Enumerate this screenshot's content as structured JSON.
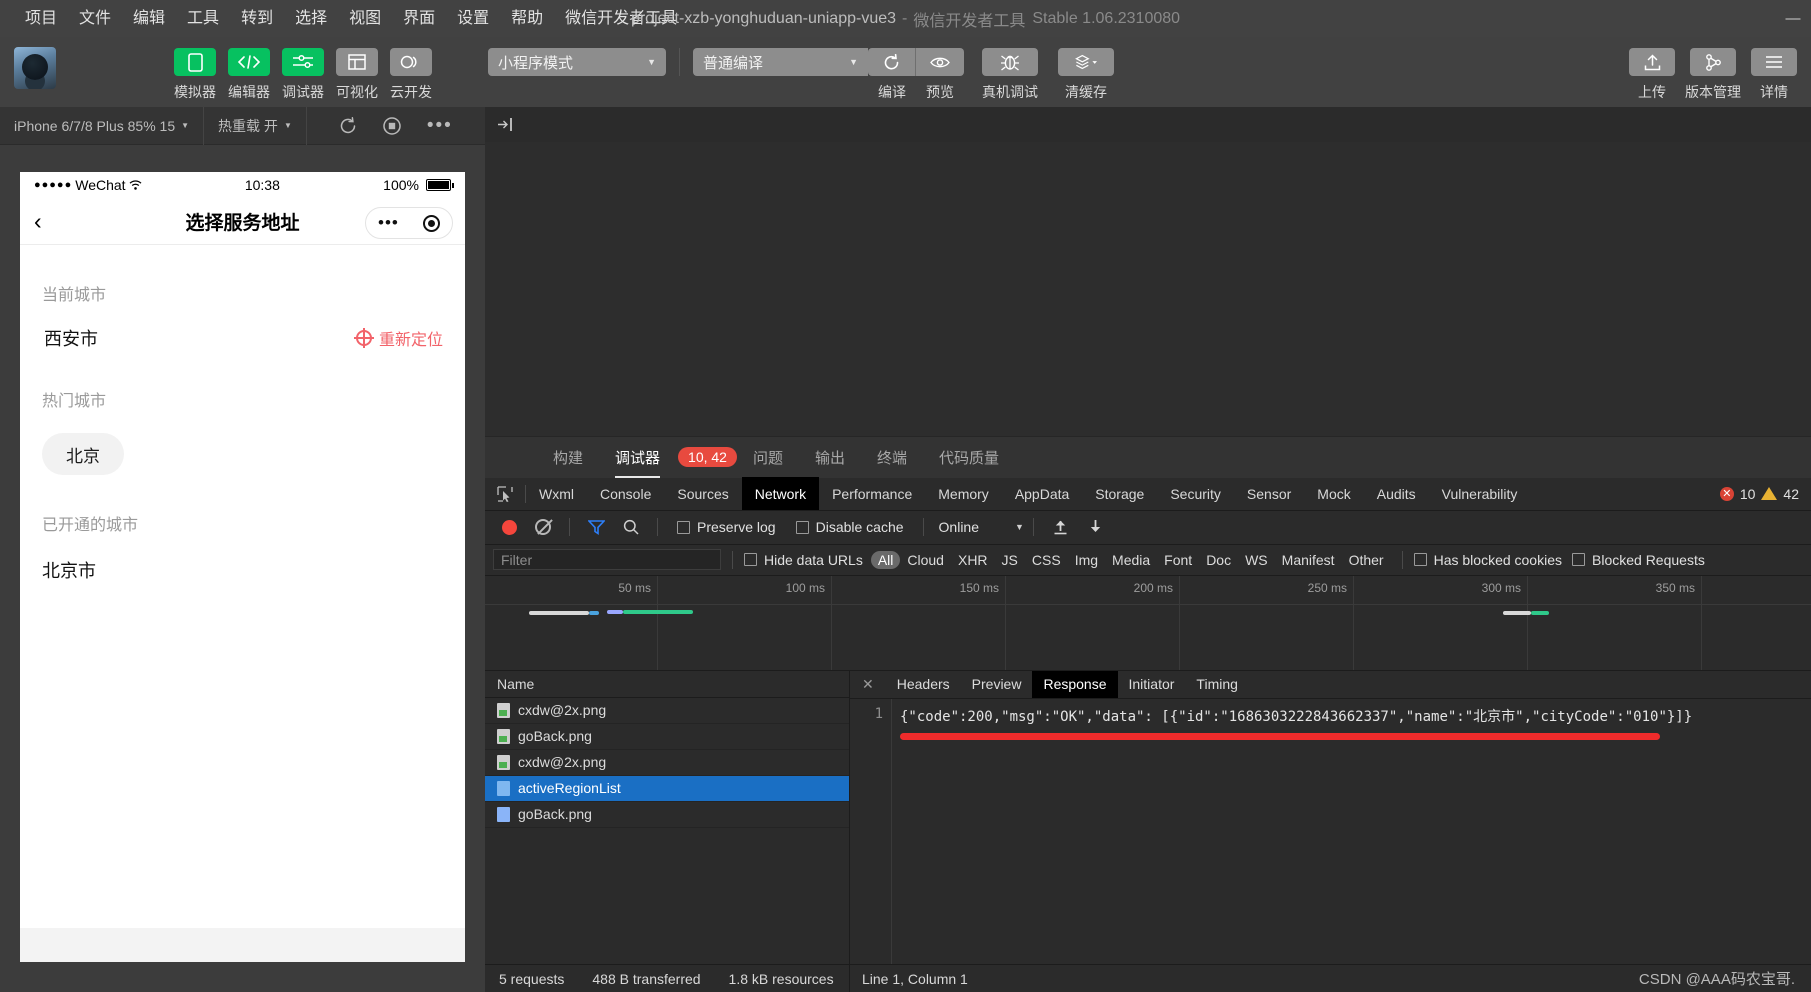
{
  "window": {
    "menu_items": [
      "项目",
      "文件",
      "编辑",
      "工具",
      "转到",
      "选择",
      "视图",
      "界面",
      "设置",
      "帮助",
      "微信开发者工具"
    ],
    "title_project": "project-xzb-yonghuduan-uniapp-vue3",
    "title_dash": "-",
    "title_app": "微信开发者工具",
    "title_version": "Stable 1.06.2310080",
    "minimize_icon": "minimize-icon"
  },
  "toolbar": {
    "avatar_name": "user-avatar",
    "buttons": [
      {
        "label": "模拟器",
        "icon": "phone-icon",
        "color": "green"
      },
      {
        "label": "编辑器",
        "icon": "code-icon",
        "color": "green"
      },
      {
        "label": "调试器",
        "icon": "sliders-icon",
        "color": "green"
      },
      {
        "label": "可视化",
        "icon": "layout-icon",
        "color": "grey"
      },
      {
        "label": "云开发",
        "icon": "cloud-icon",
        "color": "grey"
      }
    ],
    "mode_select": "小程序模式",
    "compile_select": "普通编译",
    "compile_label": "编译",
    "preview_label": "预览",
    "remote_debug_label": "真机调试",
    "clear_cache_label": "清缓存",
    "upload_label": "上传",
    "version_label": "版本管理",
    "detail_label": "详情"
  },
  "simulator": {
    "device": "iPhone 6/7/8 Plus 85% 15",
    "hot_reload": "热重载 开",
    "refresh_icon": "refresh-icon",
    "stop_icon": "stop-icon",
    "more_icon": "more-icon",
    "phone": {
      "carrier": "WeChat",
      "signal_dots": "●●●●●",
      "wifi_icon": "wifi-icon",
      "time": "10:38",
      "battery_pct": "100%",
      "back_icon": "back-chevron-icon",
      "nav_title": "选择服务地址",
      "capsule_more": "•••",
      "capsule_target_icon": "target-icon",
      "current_city_label": "当前城市",
      "current_city": "西安市",
      "relocate": "重新定位",
      "relocate_icon": "reticle-icon",
      "hot_city_label": "热门城市",
      "hot_cities": [
        "北京"
      ],
      "opened_city_label": "已开通的城市",
      "opened_cities": [
        "北京市"
      ]
    }
  },
  "panel": {
    "tabs": [
      {
        "label": "构建",
        "active": false
      },
      {
        "label": "调试器",
        "active": true,
        "badge": "10, 42"
      },
      {
        "label": "问题",
        "active": false
      },
      {
        "label": "输出",
        "active": false
      },
      {
        "label": "终端",
        "active": false
      },
      {
        "label": "代码质量",
        "active": false
      }
    ]
  },
  "devtools": {
    "cursor_icon": "inspect-cursor-icon",
    "tabs": [
      {
        "label": "Wxml",
        "active": false
      },
      {
        "label": "Console",
        "active": false
      },
      {
        "label": "Sources",
        "active": false
      },
      {
        "label": "Network",
        "active": true
      },
      {
        "label": "Performance",
        "active": false
      },
      {
        "label": "Memory",
        "active": false
      },
      {
        "label": "AppData",
        "active": false
      },
      {
        "label": "Storage",
        "active": false
      },
      {
        "label": "Security",
        "active": false
      },
      {
        "label": "Sensor",
        "active": false
      },
      {
        "label": "Mock",
        "active": false
      },
      {
        "label": "Audits",
        "active": false
      },
      {
        "label": "Vulnerability",
        "active": false
      }
    ],
    "error_count": "10",
    "warning_count": "42"
  },
  "network": {
    "record_icon": "record-icon",
    "clear_icon": "clear-icon",
    "filter_icon": "filter-funnel-icon",
    "search_icon": "search-icon",
    "preserve_log": "Preserve log",
    "disable_cache": "Disable cache",
    "throttling": "Online",
    "import_icon": "upload-arrow-icon",
    "export_icon": "download-arrow-icon",
    "filter_placeholder": "Filter",
    "hide_data_urls": "Hide data URLs",
    "types": [
      "All",
      "Cloud",
      "XHR",
      "JS",
      "CSS",
      "Img",
      "Media",
      "Font",
      "Doc",
      "WS",
      "Manifest",
      "Other"
    ],
    "active_type": "All",
    "has_blocked_cookies": "Has blocked cookies",
    "blocked_requests": "Blocked Requests",
    "timeline_ticks": [
      "50 ms",
      "100 ms",
      "150 ms",
      "200 ms",
      "250 ms",
      "300 ms",
      "350 ms"
    ],
    "name_header": "Name",
    "rows": [
      {
        "name": "cxdw@2x.png",
        "icon": "image-file-icon",
        "selected": false
      },
      {
        "name": "goBack.png",
        "icon": "image-file-icon",
        "selected": false
      },
      {
        "name": "cxdw@2x.png",
        "icon": "image-file-icon",
        "selected": false
      },
      {
        "name": "activeRegionList",
        "icon": "xhr-file-icon",
        "selected": true
      },
      {
        "name": "goBack.png",
        "icon": "image-file-icon",
        "selected": false
      }
    ],
    "detail_close_icon": "close-icon",
    "detail_tabs": [
      {
        "label": "Headers",
        "active": false
      },
      {
        "label": "Preview",
        "active": false
      },
      {
        "label": "Response",
        "active": true
      },
      {
        "label": "Initiator",
        "active": false
      },
      {
        "label": "Timing",
        "active": false
      }
    ],
    "response_line_number": "1",
    "response_body": "{\"code\":200,\"msg\":\"OK\",\"data\": [{\"id\":\"1686303222843662337\",\"name\":\"北京市\",\"cityCode\":\"010\"}]}",
    "status_requests": "5 requests",
    "status_transferred": "488 B transferred",
    "status_resources": "1.8 kB resources",
    "cursor_position": "Line 1, Column 1"
  },
  "watermark": "CSDN @AAA码农宝哥."
}
